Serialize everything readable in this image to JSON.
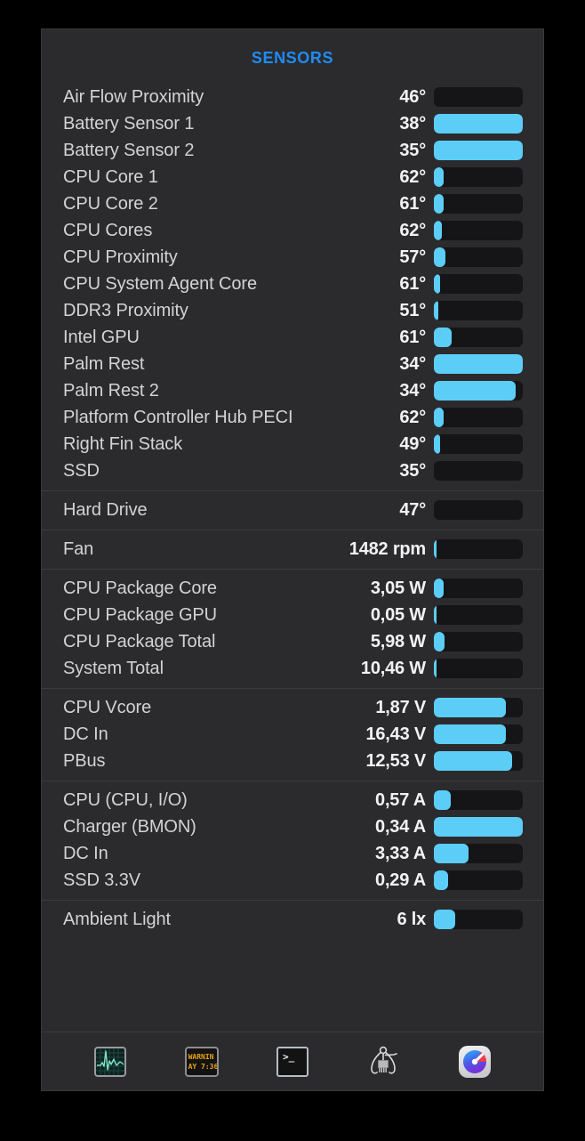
{
  "panel": {
    "title": "SENSORS",
    "accent_header_color": "#1f8cf5",
    "bar_fill_color": "#5ccdf7",
    "bar_track_color": "#151517",
    "panel_background": "#2b2b2d",
    "page_background": "#000000"
  },
  "groups": [
    {
      "name": "temperatures",
      "rows": [
        {
          "label": "Air Flow Proximity",
          "value": "46°",
          "fill_pct": 0
        },
        {
          "label": "Battery Sensor 1",
          "value": "38°",
          "fill_pct": 100
        },
        {
          "label": "Battery Sensor 2",
          "value": "35°",
          "fill_pct": 100
        },
        {
          "label": "CPU Core 1",
          "value": "62°",
          "fill_pct": 11
        },
        {
          "label": "CPU Core 2",
          "value": "61°",
          "fill_pct": 11
        },
        {
          "label": "CPU Cores",
          "value": "62°",
          "fill_pct": 9
        },
        {
          "label": "CPU Proximity",
          "value": "57°",
          "fill_pct": 13
        },
        {
          "label": "CPU System Agent Core",
          "value": "61°",
          "fill_pct": 7
        },
        {
          "label": "DDR3 Proximity",
          "value": "51°",
          "fill_pct": 5
        },
        {
          "label": "Intel GPU",
          "value": "61°",
          "fill_pct": 20
        },
        {
          "label": "Palm Rest",
          "value": "34°",
          "fill_pct": 100
        },
        {
          "label": "Palm Rest 2",
          "value": "34°",
          "fill_pct": 92
        },
        {
          "label": "Platform Controller Hub PECI",
          "value": "62°",
          "fill_pct": 11
        },
        {
          "label": "Right Fin Stack",
          "value": "49°",
          "fill_pct": 7
        },
        {
          "label": "SSD",
          "value": "35°",
          "fill_pct": 0
        }
      ]
    },
    {
      "name": "drives",
      "rows": [
        {
          "label": "Hard Drive",
          "value": "47°",
          "fill_pct": 0
        }
      ]
    },
    {
      "name": "fans",
      "rows": [
        {
          "label": "Fan",
          "value": "1482 rpm",
          "fill_pct": 3
        }
      ]
    },
    {
      "name": "power",
      "rows": [
        {
          "label": "CPU Package Core",
          "value": "3,05 W",
          "fill_pct": 11
        },
        {
          "label": "CPU Package GPU",
          "value": "0,05 W",
          "fill_pct": 3
        },
        {
          "label": "CPU Package Total",
          "value": "5,98 W",
          "fill_pct": 12
        },
        {
          "label": "System Total",
          "value": "10,46 W",
          "fill_pct": 3
        }
      ]
    },
    {
      "name": "voltages",
      "rows": [
        {
          "label": "CPU Vcore",
          "value": "1,87 V",
          "fill_pct": 81
        },
        {
          "label": "DC In",
          "value": "16,43 V",
          "fill_pct": 81
        },
        {
          "label": "PBus",
          "value": "12,53 V",
          "fill_pct": 88
        }
      ]
    },
    {
      "name": "currents",
      "rows": [
        {
          "label": "CPU (CPU, I/O)",
          "value": "0,57 A",
          "fill_pct": 19
        },
        {
          "label": "Charger (BMON)",
          "value": "0,34 A",
          "fill_pct": 100
        },
        {
          "label": "DC In",
          "value": "3,33 A",
          "fill_pct": 39
        },
        {
          "label": "SSD 3.3V",
          "value": "0,29 A",
          "fill_pct": 16
        }
      ]
    },
    {
      "name": "light",
      "rows": [
        {
          "label": "Ambient Light",
          "value": "6 lx",
          "fill_pct": 24
        }
      ]
    }
  ],
  "toolbar": {
    "items": [
      {
        "icon": "activity-monitor-icon",
        "label": "Activity Monitor"
      },
      {
        "icon": "console-warning-icon",
        "label": "Console",
        "line1": "WARNIN",
        "line2": "AY 7:36"
      },
      {
        "icon": "terminal-icon",
        "label": "Terminal",
        "prompt": ">_"
      },
      {
        "icon": "chip-probe-icon",
        "label": "Hardware Monitor"
      },
      {
        "icon": "gauge-app-icon",
        "label": "iStat Menus"
      }
    ]
  }
}
